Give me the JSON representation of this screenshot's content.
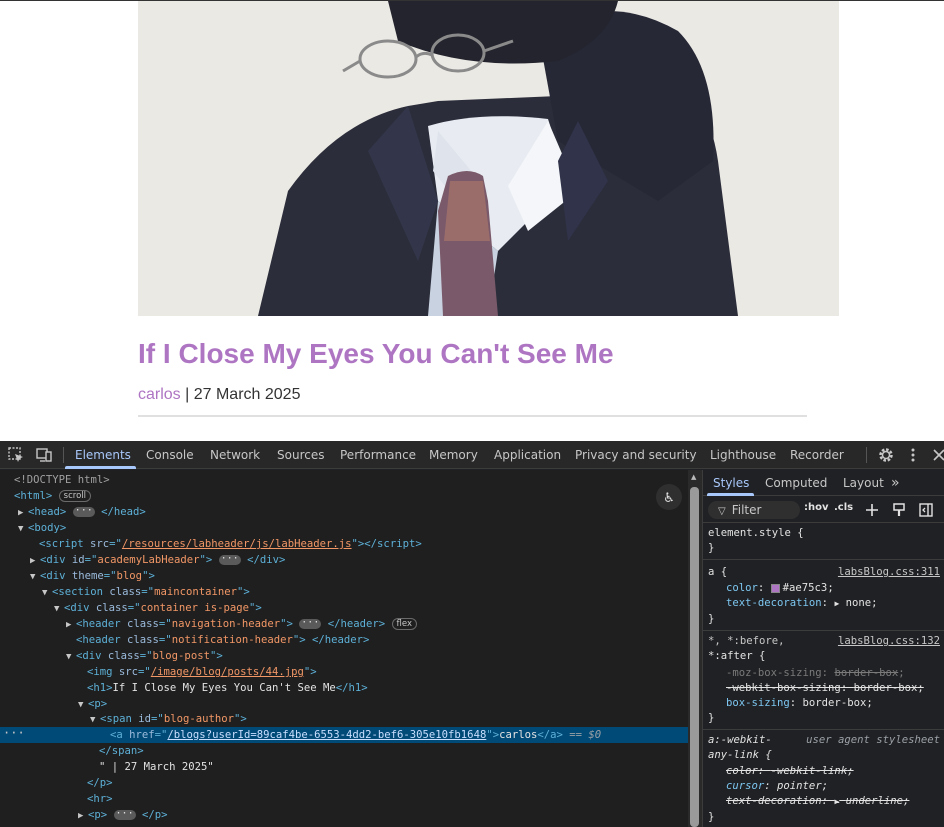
{
  "page": {
    "post_title": "If I Close My Eyes You Can't See Me",
    "author_link": "carlos",
    "date_text": " | 27 March 2025"
  },
  "devtools": {
    "tabs": [
      "Elements",
      "Console",
      "Network",
      "Sources",
      "Performance",
      "Memory",
      "Application",
      "Privacy and security",
      "Lighthouse",
      "Recorder"
    ],
    "styles_tabs": [
      "Styles",
      "Computed",
      "Layout"
    ],
    "filter_placeholder": "Filter",
    "hov_label": ":hov",
    "cls_label": ".cls",
    "dom": {
      "doctype": "<!DOCTYPE html>",
      "scroll_badge": "scroll",
      "flex_badge": "flex",
      "dollar0": "== $0",
      "script_src": "/resources/labheader/js/labHeader.js",
      "academy_id": "academyLabHeader",
      "theme": "blog",
      "section_class": "maincontainer",
      "container_class": "container is-page",
      "nav_class": "navigation-header",
      "notif_class": "notification-header",
      "blogpost_class": "blog-post",
      "img_src": "/image/blog/posts/44.jpg",
      "h1_text": "If I Close My Eyes You Can't See Me",
      "span_id": "blog-author",
      "a_href": "/blogs?userId=89caf4be-6553-4dd2-bef6-305e10fb1648",
      "a_text": "carlos",
      "date_node": "\" | 27 March 2025\""
    },
    "styles": {
      "element_style": "element.style {",
      "a_selector": "a {",
      "a_source": "labsBlog.css:311",
      "a_color_name": "color",
      "a_color_value": "#ae75c3",
      "a_textdeco_name": "text-decoration",
      "a_textdeco_value": "none",
      "star_selector_1": "*, *:before,",
      "star_selector_2": "*:after {",
      "star_source": "labsBlog.css:132",
      "moz_name": "-moz-box-sizing",
      "moz_value": "border-box",
      "webkit_name": "-webkit-box-sizing",
      "webkit_value": "border-box",
      "bs_name": "box-sizing",
      "bs_value": "border-box",
      "ua_selector_1": "a:-webkit-",
      "ua_selector_2": "any-link {",
      "ua_source": "user agent stylesheet",
      "ua_color_name": "color",
      "ua_color_value": "-webkit-link",
      "ua_cursor_name": "cursor",
      "ua_cursor_value": "pointer",
      "ua_td_name": "text-decoration",
      "ua_td_value": "underline"
    },
    "colors": {
      "accent": "#a8c7fa",
      "link_purple": "#ae75c3",
      "selection": "#004a77"
    }
  }
}
